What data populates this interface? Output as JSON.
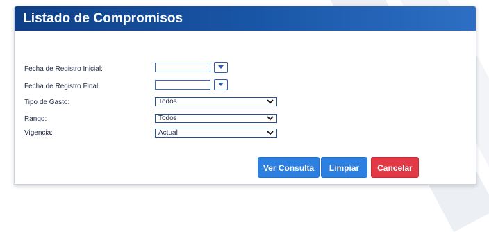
{
  "header": {
    "title": "Listado de Compromisos"
  },
  "form": {
    "fecha_inicial": {
      "label": "Fecha de Registro Inicial:",
      "value": ""
    },
    "fecha_final": {
      "label": "Fecha de Registro Final:",
      "value": ""
    },
    "tipo_gasto": {
      "label": "Tipo de Gasto:",
      "selected": "Todos"
    },
    "rango": {
      "label": "Rango:",
      "selected": "Todos"
    },
    "vigencia": {
      "label": "Vigencia:",
      "selected": "Actual"
    }
  },
  "actions": {
    "consulta": "Ver Consulta",
    "limpiar": "Limpiar",
    "cancelar": "Cancelar"
  },
  "colors": {
    "header": "#1a57a8",
    "primary_button": "#2d7fe0",
    "danger_button": "#e23946"
  },
  "icons": {
    "date_dropdown": "caret-down-icon",
    "select_arrow": "chevron-down-icon"
  }
}
